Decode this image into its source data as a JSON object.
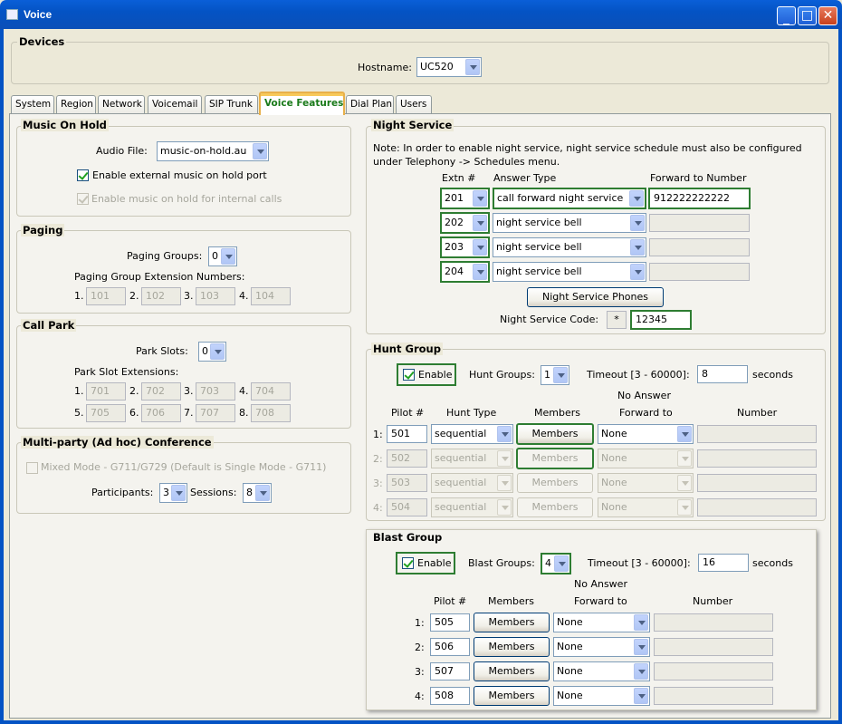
{
  "window": {
    "title": "Voice"
  },
  "devices": {
    "title": "Devices",
    "hostname_label": "Hostname:",
    "hostname_value": "UC520"
  },
  "tabs": [
    "System",
    "Region",
    "Network",
    "Voicemail",
    "SIP Trunk",
    "Voice Features",
    "Dial Plan",
    "Users"
  ],
  "moh": {
    "title": "Music On Hold",
    "audio_label": "Audio File:",
    "audio_value": "music-on-hold.au",
    "ext_label": "Enable external music on hold port",
    "int_label": "Enable music on hold for internal calls"
  },
  "paging": {
    "title": "Paging",
    "groups_label": "Paging Groups:",
    "groups_value": "0",
    "ext_label": "Paging Group Extension Numbers:",
    "idx": [
      "1.",
      "2.",
      "3.",
      "4."
    ],
    "ext": [
      "101",
      "102",
      "103",
      "104"
    ]
  },
  "callpark": {
    "title": "Call Park",
    "slots_label": "Park Slots:",
    "slots_value": "0",
    "ext_label": "Park Slot Extensions:",
    "idx": [
      "1.",
      "2.",
      "3.",
      "4.",
      "5.",
      "6.",
      "7.",
      "8."
    ],
    "ext": [
      "701",
      "702",
      "703",
      "704",
      "705",
      "706",
      "707",
      "708"
    ]
  },
  "conf": {
    "title": "Multi-party (Ad hoc) Conference",
    "mixed_label": "Mixed Mode - G711/G729 (Default is Single Mode - G711)",
    "participants_label": "Participants:",
    "participants_value": "3",
    "sessions_label": "Sessions:",
    "sessions_value": "8"
  },
  "night": {
    "title": "Night Service",
    "note": "Note: In order to enable night service, night service schedule must also be configured under Telephony -> Schedules menu.",
    "col_extn": "Extn #",
    "col_answer": "Answer Type",
    "col_forward": "Forward to Number",
    "rows": [
      {
        "extn": "201",
        "answer": "call forward night service",
        "forward": "912222222222"
      },
      {
        "extn": "202",
        "answer": "night service bell",
        "forward": ""
      },
      {
        "extn": "203",
        "answer": "night service bell",
        "forward": ""
      },
      {
        "extn": "204",
        "answer": "night service bell",
        "forward": ""
      }
    ],
    "phones_button": "Night Service Phones",
    "code_label": "Night Service Code:",
    "code_prefix": "*",
    "code_value": "12345"
  },
  "hunt": {
    "title": "Hunt Group",
    "enable_label": "Enable",
    "groups_label": "Hunt Groups:",
    "groups_value": "1",
    "timeout_label": "Timeout [3 - 60000]:",
    "timeout_value": "8",
    "seconds": "seconds",
    "col_pilot": "Pilot #",
    "col_type": "Hunt Type",
    "col_members": "Members",
    "col_noanswer": "No Answer",
    "col_forward": "Forward to",
    "col_number": "Number",
    "rows": [
      {
        "idx": "1:",
        "pilot": "501",
        "type": "sequential",
        "members": "Members",
        "forward": "None"
      },
      {
        "idx": "2:",
        "pilot": "502",
        "type": "sequential",
        "members": "Members",
        "forward": "None"
      },
      {
        "idx": "3:",
        "pilot": "503",
        "type": "sequential",
        "members": "Members",
        "forward": "None"
      },
      {
        "idx": "4:",
        "pilot": "504",
        "type": "sequential",
        "members": "Members",
        "forward": "None"
      }
    ]
  },
  "blast": {
    "title": "Blast Group",
    "enable_label": "Enable",
    "groups_label": "Blast Groups:",
    "groups_value": "4",
    "timeout_label": "Timeout [3 - 60000]:",
    "timeout_value": "16",
    "seconds": "seconds",
    "col_pilot": "Pilot #",
    "col_members": "Members",
    "col_noanswer": "No Answer",
    "col_forward": "Forward to",
    "col_number": "Number",
    "rows": [
      {
        "idx": "1:",
        "pilot": "505",
        "members": "Members",
        "forward": "None"
      },
      {
        "idx": "2:",
        "pilot": "506",
        "members": "Members",
        "forward": "None"
      },
      {
        "idx": "3:",
        "pilot": "507",
        "members": "Members",
        "forward": "None"
      },
      {
        "idx": "4:",
        "pilot": "508",
        "members": "Members",
        "forward": "None"
      }
    ]
  }
}
